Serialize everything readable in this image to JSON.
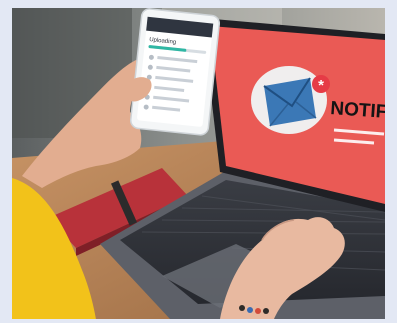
{
  "scene": {
    "colors": {
      "background": "#e3e8f4",
      "screen_red": "#ea5a55",
      "notebook_red": "#b8323a",
      "sleeve_yellow": "#f2c21a",
      "envelope_blue": "#3b78b6"
    }
  },
  "phone": {
    "header": "Uploading",
    "list_rows": 6
  },
  "laptop": {
    "screen_text": "NOTIFI",
    "badge_symbol": "*"
  },
  "icons": [
    "envelope-icon"
  ]
}
